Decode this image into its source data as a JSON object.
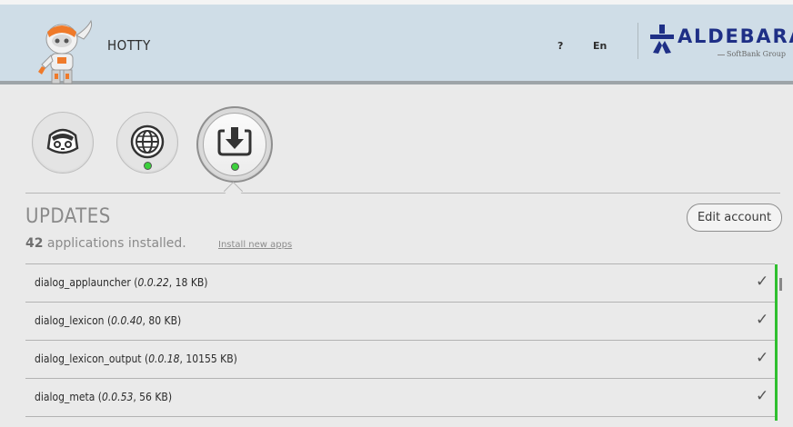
{
  "header": {
    "robot_name": "HOTTY",
    "help_label": "?",
    "lang_label": "En",
    "brand": "ALDEBARAN",
    "brand_sub": "SoftBank Group",
    "brand_color": "#1e2f86",
    "bg_color": "#cfdde7"
  },
  "nav": {
    "icons": [
      "robot-face-icon",
      "globe-icon",
      "download-icon"
    ],
    "active_index": 2,
    "status_color": "#3bd13b"
  },
  "updates": {
    "title": "UPDATES",
    "count_number": "42",
    "count_text": " applications installed.",
    "install_link": "Install new apps",
    "edit_button": "Edit account"
  },
  "apps": [
    {
      "name": "dialog_applauncher (",
      "version": "0.0.22",
      "size": ", 18 KB)",
      "check": "✓"
    },
    {
      "name": "dialog_lexicon (",
      "version": "0.0.40",
      "size": ", 80 KB)",
      "check": "✓"
    },
    {
      "name": "dialog_lexicon_output (",
      "version": "0.0.18",
      "size": ", 10155 KB)",
      "check": "✓"
    },
    {
      "name": "dialog_meta (",
      "version": "0.0.53",
      "size": ", 56 KB)",
      "check": "✓"
    }
  ]
}
